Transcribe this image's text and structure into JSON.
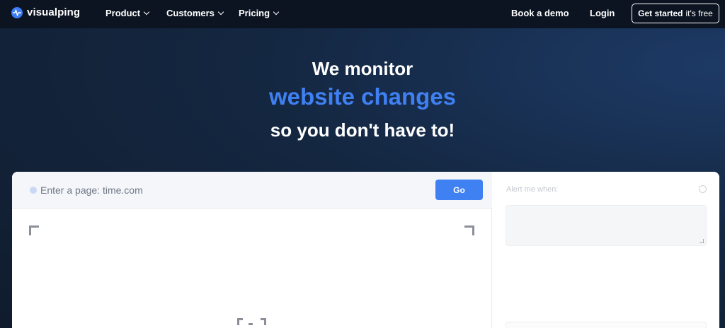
{
  "brand": {
    "name": "visualping"
  },
  "nav": {
    "items": [
      {
        "label": "Product"
      },
      {
        "label": "Customers"
      },
      {
        "label": "Pricing"
      }
    ],
    "book_demo": "Book a demo",
    "login": "Login",
    "cta_strong": "Get started",
    "cta_rest": "it's free"
  },
  "hero": {
    "line1": "We monitor",
    "line2": "website changes",
    "line3": "so you don't have to!"
  },
  "form": {
    "url_placeholder": "Enter a page: time.com",
    "url_value": "",
    "go_label": "Go",
    "alert_label": "Alert me when:"
  },
  "colors": {
    "accent": "#3f80f2",
    "nav_bg": "#0c1422",
    "hero_bg": "#142741"
  }
}
